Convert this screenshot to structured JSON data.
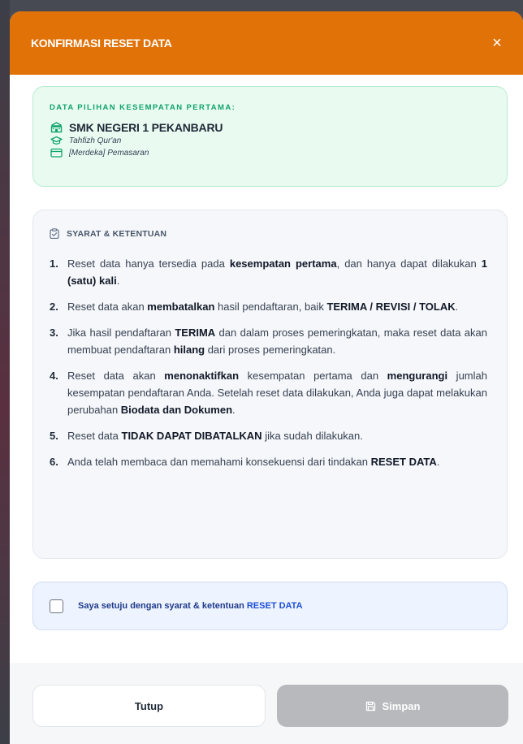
{
  "modal": {
    "title": "KONFIRMASI RESET DATA",
    "close_symbol": "×",
    "colors": {
      "header": "#e07208",
      "success": "#10a36a",
      "link": "#1d4ed8"
    }
  },
  "selection": {
    "heading": "DATA PILIHAN KESEMPATAN PERTAMA:",
    "school": "SMK NEGERI 1 PEKANBARU",
    "program": "Tahfizh Qur'an",
    "major": "[Merdeka] Pemasaran",
    "icons": [
      "school-icon",
      "graduation-cap-icon",
      "card-icon"
    ]
  },
  "terms": {
    "heading": "SYARAT & KETENTUAN",
    "icon": "clipboard-check-icon",
    "items": [
      {
        "num": "1.",
        "parts": [
          {
            "t": "Reset data hanya tersedia pada "
          },
          {
            "t": "kesempatan pertama",
            "b": true
          },
          {
            "t": ", dan hanya dapat dilakukan "
          },
          {
            "t": "1 (satu) kali",
            "b": true
          },
          {
            "t": "."
          }
        ]
      },
      {
        "num": "2.",
        "parts": [
          {
            "t": "Reset data akan "
          },
          {
            "t": "membatalkan",
            "b": true
          },
          {
            "t": " hasil pendaftaran, baik "
          },
          {
            "t": "TERIMA / REVISI / TOLAK",
            "b": true
          },
          {
            "t": "."
          }
        ]
      },
      {
        "num": "3.",
        "parts": [
          {
            "t": "Jika hasil pendaftaran "
          },
          {
            "t": "TERIMA",
            "b": true
          },
          {
            "t": " dan dalam proses pemeringkatan, maka reset data akan membuat pendaftaran "
          },
          {
            "t": "hilang",
            "b": true
          },
          {
            "t": " dari proses pemeringkatan."
          }
        ]
      },
      {
        "num": "4.",
        "parts": [
          {
            "t": "Reset data akan "
          },
          {
            "t": "menonaktifkan",
            "b": true
          },
          {
            "t": " kesempatan pertama dan "
          },
          {
            "t": "mengurangi",
            "b": true
          },
          {
            "t": " jumlah kesempatan pendaftaran Anda. Setelah reset data dilakukan, Anda juga dapat melakukan perubahan "
          },
          {
            "t": "Biodata dan Dokumen",
            "b": true
          },
          {
            "t": "."
          }
        ]
      },
      {
        "num": "5.",
        "parts": [
          {
            "t": "Reset data "
          },
          {
            "t": "TIDAK DAPAT DIBATALKAN",
            "b": true
          },
          {
            "t": " jika sudah dilakukan."
          }
        ]
      },
      {
        "num": "6.",
        "parts": [
          {
            "t": "Anda telah membaca dan memahami konsekuensi dari tindakan "
          },
          {
            "t": "RESET DATA",
            "b": true
          },
          {
            "t": "."
          }
        ]
      }
    ]
  },
  "agreement": {
    "checked": false,
    "text_prefix": "Saya setuju dengan syarat & ketentuan ",
    "text_strong": "RESET DATA"
  },
  "footer": {
    "close_label": "Tutup",
    "save_label": "Simpan",
    "save_icon": "save-icon",
    "save_disabled": true
  }
}
